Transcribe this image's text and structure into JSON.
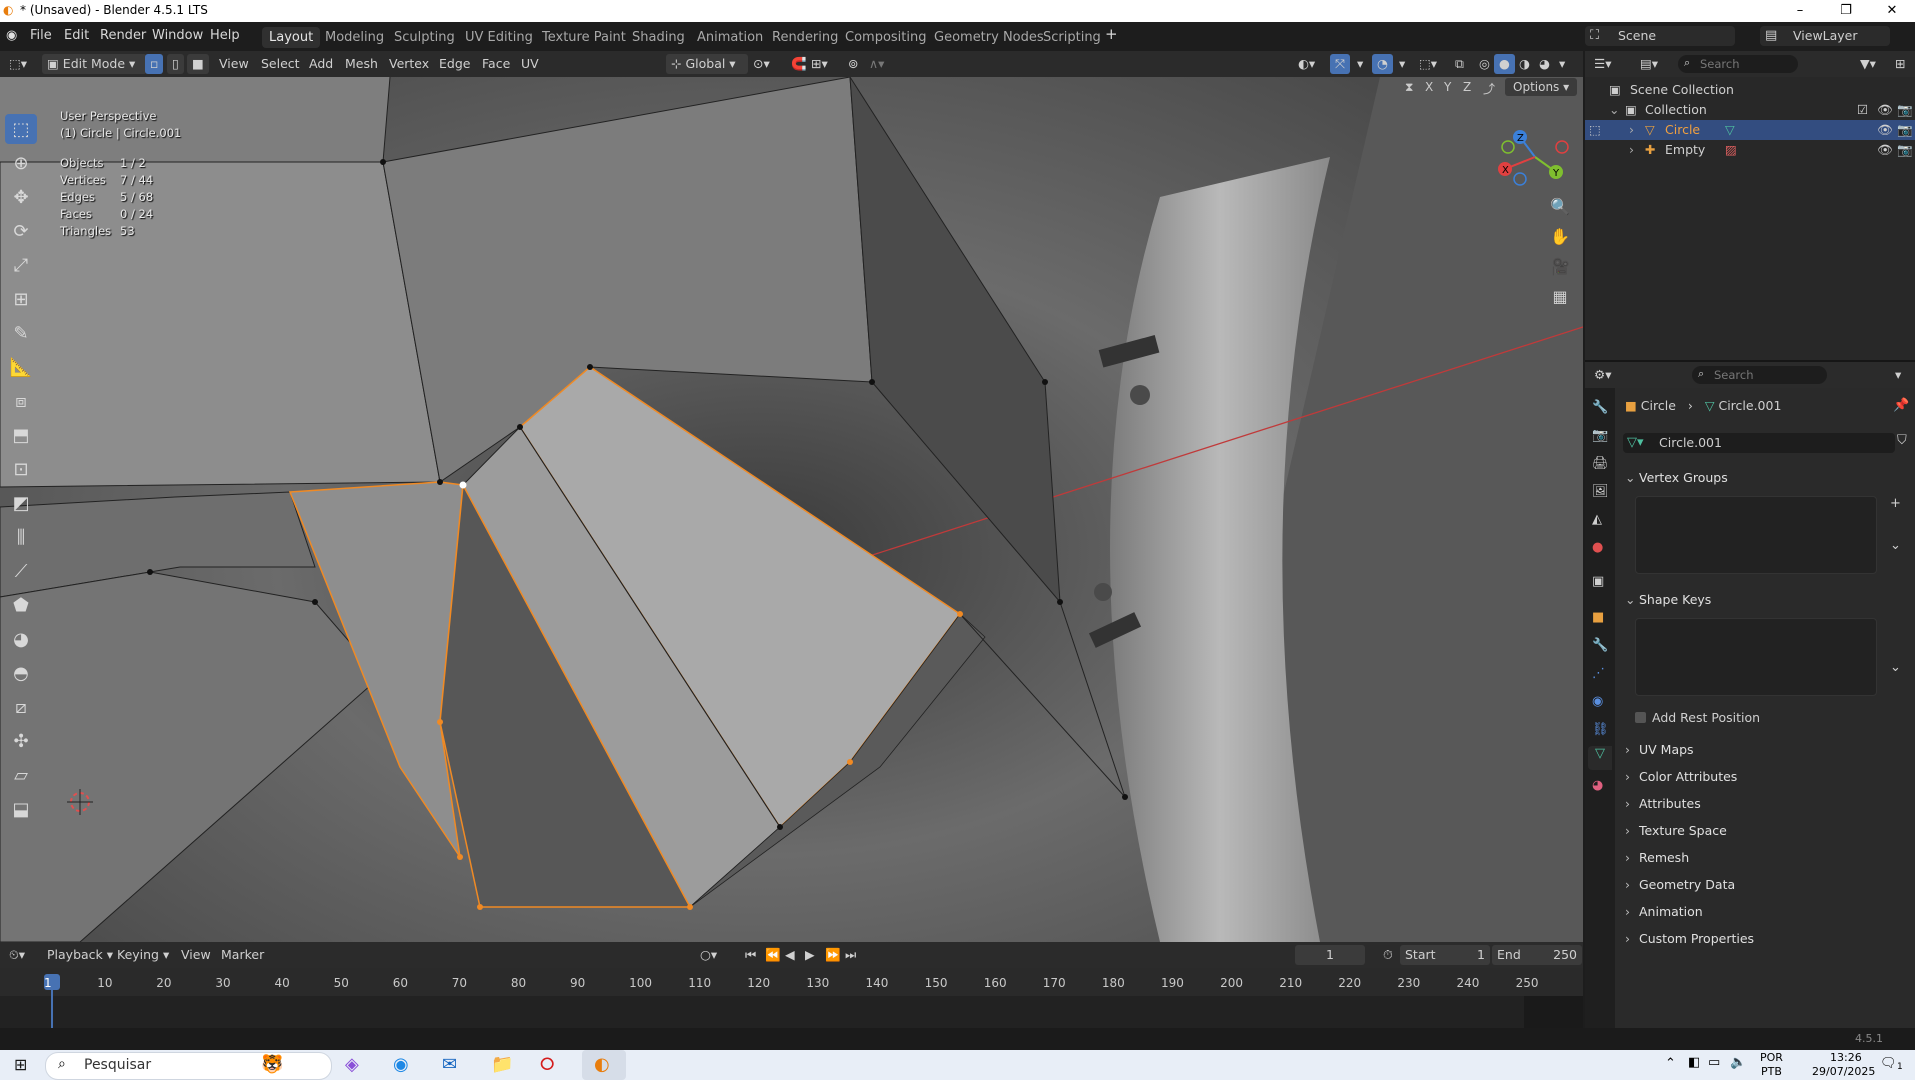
{
  "window": {
    "title": "* (Unsaved) - Blender 4.5.1 LTS"
  },
  "menus": [
    "File",
    "Edit",
    "Render",
    "Window",
    "Help"
  ],
  "workspaces": [
    "Layout",
    "Modeling",
    "Sculpting",
    "UV Editing",
    "Texture Paint",
    "Shading",
    "Animation",
    "Rendering",
    "Compositing",
    "Geometry Nodes",
    "Scripting"
  ],
  "scene": {
    "name": "Scene",
    "view_layer": "ViewLayer"
  },
  "viewport_header": {
    "mode": "Edit Mode",
    "items": [
      "View",
      "Select",
      "Add",
      "Mesh",
      "Vertex",
      "Edge",
      "Face",
      "UV"
    ],
    "transform": "Global",
    "options": "Options",
    "axes": [
      "X",
      "Y",
      "Z"
    ]
  },
  "overlay_text": {
    "perspective": "User Perspective",
    "object": "(1) Circle | Circle.001"
  },
  "stats": [
    {
      "label": "Objects",
      "value": "1 / 2"
    },
    {
      "label": "Vertices",
      "value": "7 / 44"
    },
    {
      "label": "Edges",
      "value": "5 / 68"
    },
    {
      "label": "Faces",
      "value": "0 / 24"
    },
    {
      "label": "Triangles",
      "value": "53"
    }
  ],
  "gizmo": {
    "x": "X",
    "y": "Y",
    "z": "Z"
  },
  "outliner": {
    "search_placeholder": "Search",
    "root": "Scene Collection",
    "collection": "Collection",
    "items": [
      "Circle",
      "Empty"
    ]
  },
  "properties": {
    "search_placeholder": "Search",
    "breadcrumb_object": "Circle",
    "breadcrumb_data": "Circle.001",
    "data_name": "Circle.001",
    "panels_open": [
      "Vertex Groups",
      "Shape Keys"
    ],
    "add_rest_position": "Add Rest Position",
    "panels_closed": [
      "UV Maps",
      "Color Attributes",
      "Attributes",
      "Texture Space",
      "Remesh",
      "Geometry Data",
      "Animation",
      "Custom Properties"
    ]
  },
  "timeline": {
    "menus": [
      "Playback",
      "Keying",
      "View",
      "Marker"
    ],
    "current_frame": "1",
    "start_label": "Start",
    "start": "1",
    "end_label": "End",
    "end": "250",
    "ticks": [
      "1",
      "10",
      "20",
      "30",
      "40",
      "50",
      "60",
      "70",
      "80",
      "90",
      "100",
      "110",
      "120",
      "130",
      "140",
      "150",
      "160",
      "170",
      "180",
      "190",
      "200",
      "210",
      "220",
      "230",
      "240",
      "250"
    ]
  },
  "statusbar": {
    "version": "4.5.1"
  },
  "taskbar": {
    "search_placeholder": "Pesquisar",
    "lang1": "POR",
    "lang2": "PTB",
    "time": "13:26",
    "date": "29/07/2025",
    "notifications": "1"
  },
  "colors": {
    "selected": "#4772b3",
    "edge_select": "#f08a24",
    "x_axis": "#e04040",
    "y_axis": "#7fbf2f",
    "z_axis": "#3b80d9"
  }
}
